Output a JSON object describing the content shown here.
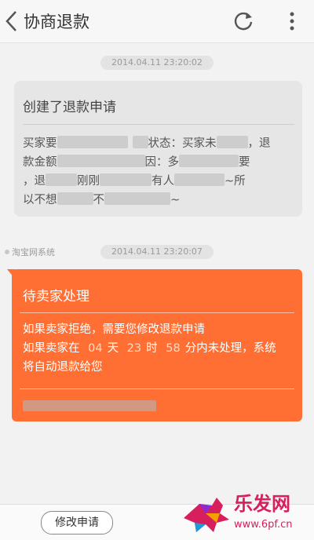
{
  "header": {
    "title": "协商退款",
    "back_icon": "chevron-left-icon",
    "refresh_icon": "refresh-icon",
    "more_icon": "more-vertical-icon"
  },
  "message1": {
    "timestamp": "2014.04.11 23:20:02",
    "title": "创建了退款申请",
    "body": {
      "line1_a": "买家要",
      "line1_b": "状态：买家未",
      "line1_c": "，退",
      "line2_a": "款金额",
      "line2_b": "因：多",
      "line2_c": "要",
      "line3_a": "，退",
      "line3_b": "刚刚",
      "line3_c": "有人",
      "line3_d": "~所",
      "line4_a": "以不想",
      "line4_b": "不",
      "line4_c": "~"
    }
  },
  "message2": {
    "sender": "淘宝网系统",
    "timestamp": "2014.04.11 23:20:07",
    "title": "待卖家处理",
    "line1": "如果卖家拒绝，需要您修改退款申请",
    "line2_prefix": "如果卖家在",
    "days": "04",
    "day_unit": "天",
    "hours": "23",
    "hour_unit": "时",
    "minutes": "58",
    "minute_suffix": "分内未处理，系统",
    "line3": "将自动退款给您"
  },
  "bottom": {
    "modify_button": "修改申请"
  },
  "watermark": {
    "brand": "乐发网",
    "url": "www.6pf.cn"
  },
  "colors": {
    "accent": "#ff6f33",
    "card_gray": "#e6e6e6"
  }
}
